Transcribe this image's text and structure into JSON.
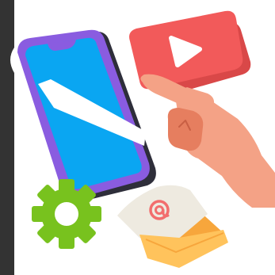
{
  "scene": {
    "elements": [
      "left-edge-bar",
      "smartphone",
      "video-play-card",
      "pointing-hand",
      "settings-gear",
      "email-envelope"
    ],
    "email_symbol": "@"
  },
  "icons": {
    "play": "play-icon",
    "gear": "gear-icon",
    "email": "envelope-icon",
    "at": "at-sign-icon"
  },
  "colors": {
    "edge_bar": "#333333",
    "phone_frame": "#8a5ce0",
    "phone_back": "#2e2e3a",
    "phone_screen": "#0aa6f2",
    "phone_stripe": "#ffffff",
    "play_card": "#f25a5a",
    "play_triangle": "#ffffff",
    "hand_skin": "#f4a286",
    "hand_shadow": "#e67e5f",
    "gear": "#78c21e",
    "envelope": "#ffc35c",
    "envelope_flap": "#f7a63c",
    "letter_paper": "#eeeae0",
    "at_sign": "#f26d6d"
  }
}
